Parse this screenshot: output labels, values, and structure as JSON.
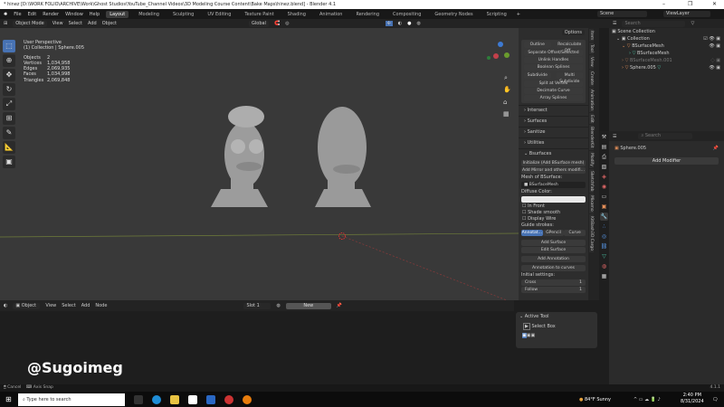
{
  "window": {
    "title": "* hinez [D:\\WORK FOLIO\\ARCHIVE\\Work\\Ghost Studios\\YouTube_Channel Videos\\3D Modeling Course Content\\Bake Maps\\hinez.blend] - Blender 4.1",
    "minimize": "–",
    "restore": "❐",
    "close": "✕"
  },
  "menu": {
    "items": [
      "File",
      "Edit",
      "Render",
      "Window",
      "Help"
    ],
    "workspaces": [
      "Layout",
      "Modeling",
      "Sculpting",
      "UV Editing",
      "Texture Paint",
      "Shading",
      "Animation",
      "Rendering",
      "Compositing",
      "Geometry Nodes",
      "Scripting"
    ],
    "active_workspace": "Layout",
    "add_tab": "+",
    "scene": "Scene",
    "view_layer": "ViewLayer"
  },
  "viewport_header": {
    "mode": "Object Mode",
    "items": [
      "View",
      "Select",
      "Add",
      "Object"
    ],
    "orientation": "Global",
    "options": "Options"
  },
  "overlay": {
    "view": "User Perspective",
    "context": "(1) Collection | Sphere.005",
    "stats": [
      {
        "k": "Objects",
        "v": "2"
      },
      {
        "k": "Vertices",
        "v": "1,034,958"
      },
      {
        "k": "Edges",
        "v": "2,069,935"
      },
      {
        "k": "Faces",
        "v": "1,034,998"
      },
      {
        "k": "Triangles",
        "v": "2,069,848"
      }
    ]
  },
  "tools": [
    "select-box",
    "cursor",
    "move",
    "rotate",
    "scale",
    "transform",
    "annotate",
    "measure",
    "add-cube"
  ],
  "npanel": {
    "buttons": [
      "Outline",
      "Recalculate Off…",
      "Separate Offset/Selected",
      "Unlink Handles",
      "Boolean Splines",
      "Subdivide",
      "Multi Subdivide",
      "Split at Vertex",
      "Decimate Curve",
      "Array Splines"
    ],
    "sections": [
      "Intersect",
      "Surfaces",
      "Sanitize",
      "Utilities"
    ],
    "bsurfaces": {
      "title": "Bsurfaces",
      "init": "Initialize (Add BSurface mesh)",
      "mirror": "Add Mirror and others modifi…",
      "mesh_label": "Mesh of BSurface:",
      "mesh": "BSurfaceMesh",
      "diffuse_label": "Diffuse Color:",
      "checks": [
        "In Front",
        "Shade smooth",
        "Display Wire"
      ],
      "guide_label": "Guide strokes:",
      "guide_options": [
        "Annotat…",
        "GPencil",
        "Curve"
      ],
      "guide_selected": "Annotat…",
      "add_surface": "Add Surface",
      "edit_surface": "Edit Surface",
      "add_annotation": "Add Annotation",
      "annotation_to_curves": "Annotation to curves",
      "initial_label": "Initial settings:",
      "cross_label": "Cross",
      "cross_value": "1",
      "follow_label": "Follow",
      "follow_value": "1"
    }
  },
  "ntabs": [
    "Item",
    "Tool",
    "View",
    "Create",
    "Animation",
    "Edit",
    "BlenderKit",
    "Modify",
    "Sketchfab",
    "Mixamo",
    "KitBash3D Cargo"
  ],
  "outliner": {
    "search_placeholder": "Search",
    "rows": [
      {
        "label": "Scene Collection",
        "indent": 0
      },
      {
        "label": "Collection",
        "indent": 1
      },
      {
        "label": "BSurfaceMesh",
        "indent": 2
      },
      {
        "label": "BSurfaceMesh",
        "indent": 3
      },
      {
        "label": "BSurfaceMesh.001",
        "indent": 2
      },
      {
        "label": "Sphere.005",
        "indent": 2
      }
    ]
  },
  "properties": {
    "search_placeholder": "Search",
    "object": "Sphere.005",
    "add_modifier": "Add Modifier"
  },
  "node_header": {
    "editor": "Object",
    "items": [
      "View",
      "Select",
      "Add",
      "Node"
    ],
    "slot": "Slot 1",
    "new": "New"
  },
  "active_tool": {
    "title": "Active Tool",
    "tool": "Select Box"
  },
  "status": {
    "items": [
      "Cancel",
      "Axis Snap"
    ],
    "version": "4.1.1"
  },
  "watermark": "@Sugoimeg",
  "taskbar": {
    "search_placeholder": "Type here to search",
    "weather_temp": "84°F",
    "weather": "Sunny",
    "time": "2:40 PM",
    "date": "8/31/2024"
  },
  "colors": {
    "accent": "#4772b3",
    "viewport": "#393939",
    "panel": "#2d2d2d"
  }
}
